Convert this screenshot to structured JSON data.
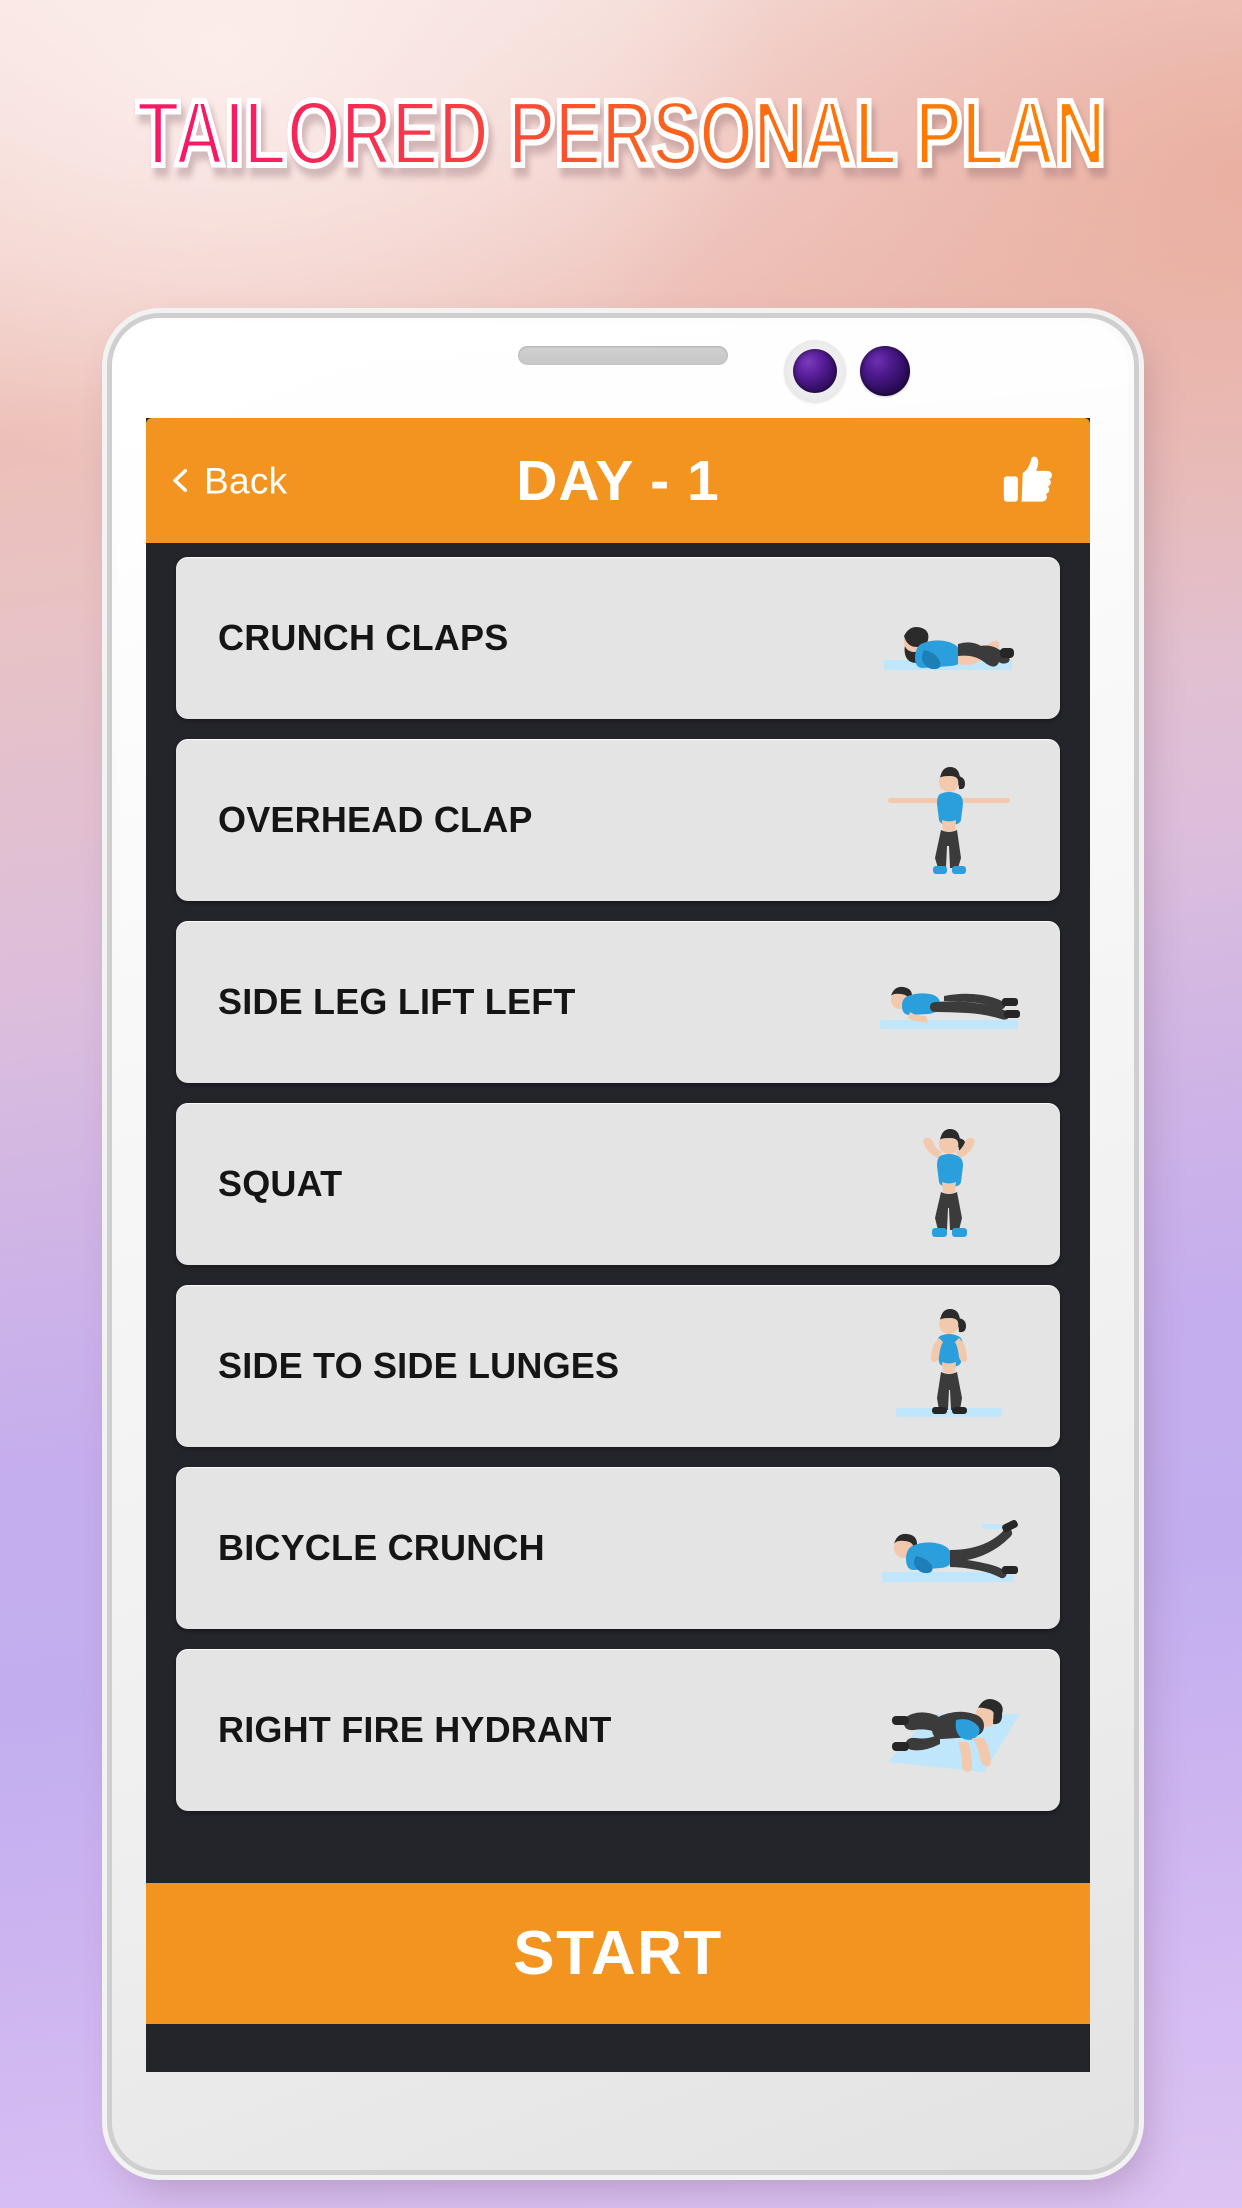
{
  "headline": "TAILORED PERSONAL PLAN",
  "colors": {
    "accent_orange": "#f2941f",
    "screen_background": "#24242b",
    "card_background": "#e4e4e4",
    "card_text": "#151515",
    "headline_gradient_start": "#f7156a",
    "headline_gradient_end": "#fe8400",
    "figure_top": "#2b9fdc",
    "figure_pants": "#3b3b3b",
    "figure_mat": "#bfe6fb"
  },
  "appbar": {
    "back_label": "Back",
    "back_icon": "chevron-left-icon",
    "title": "DAY - 1",
    "like_icon": "thumbs-up-icon"
  },
  "exercises": [
    {
      "name": "CRUNCH CLAPS",
      "figure": "crunch-claps-figure"
    },
    {
      "name": "OVERHEAD CLAP",
      "figure": "overhead-clap-figure"
    },
    {
      "name": "SIDE LEG LIFT LEFT",
      "figure": "side-leg-lift-left-figure"
    },
    {
      "name": "SQUAT",
      "figure": "squat-figure"
    },
    {
      "name": "SIDE TO SIDE LUNGES",
      "figure": "side-to-side-lunges-figure"
    },
    {
      "name": "BICYCLE CRUNCH",
      "figure": "bicycle-crunch-figure"
    },
    {
      "name": "RIGHT FIRE HYDRANT",
      "figure": "right-fire-hydrant-figure"
    }
  ],
  "start_button": {
    "label": "START"
  }
}
